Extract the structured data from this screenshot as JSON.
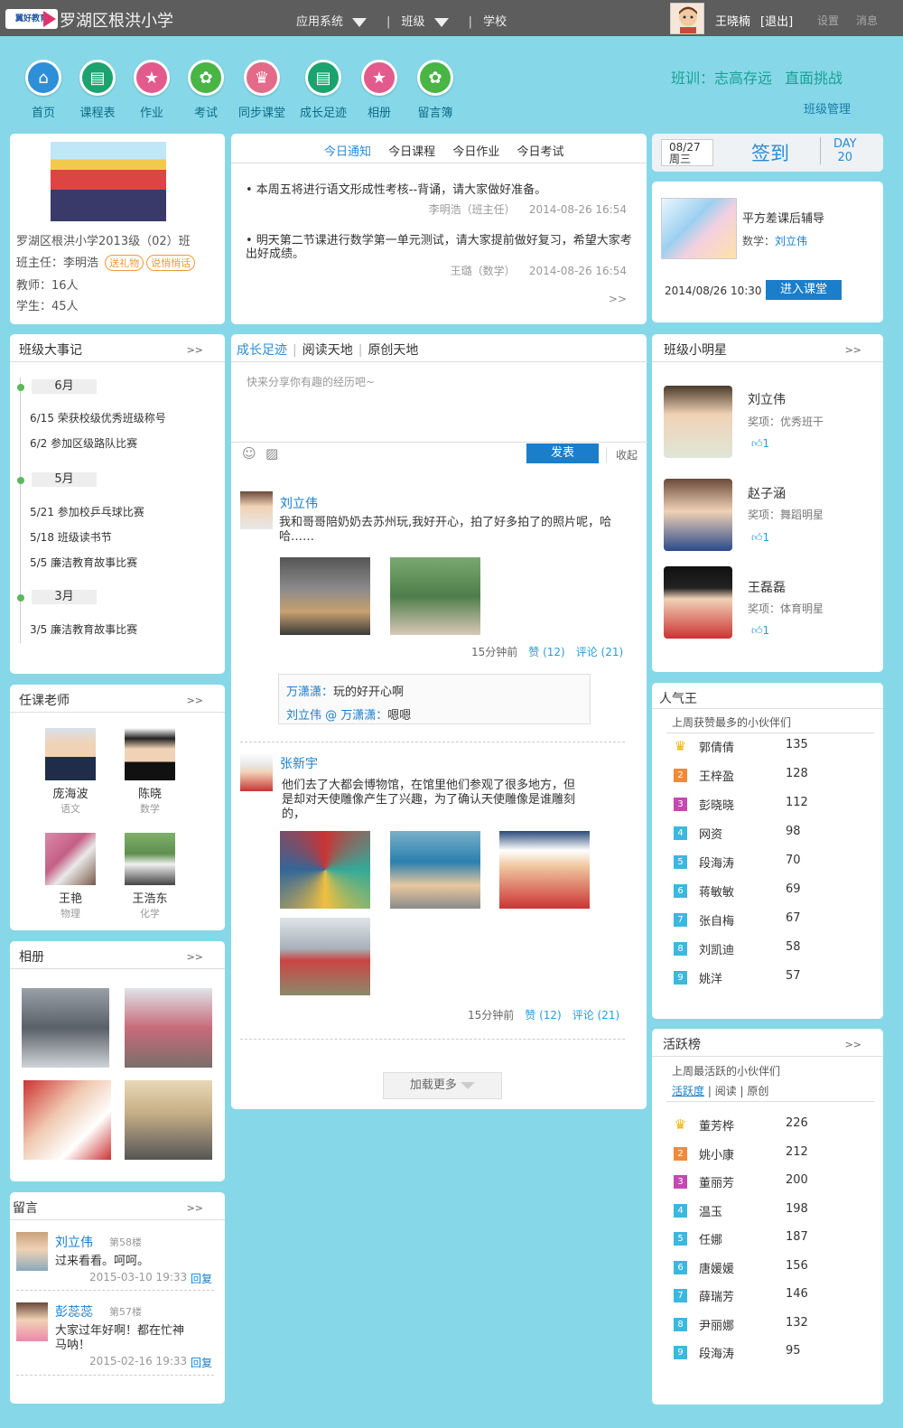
{
  "top": {
    "logo_text": "翼好教育",
    "school": "罗湖区根洪小学",
    "nav": [
      "应用系统",
      "班级",
      "学校"
    ],
    "user": "王晓楠",
    "logout": "[退出]",
    "settings": "设置",
    "messages": "消息"
  },
  "iconnav": [
    {
      "label": "首页",
      "color": "#2d8fd8"
    },
    {
      "label": "课程表",
      "color": "#1aa36f"
    },
    {
      "label": "作业",
      "color": "#e25b8c"
    },
    {
      "label": "考试",
      "color": "#48b545"
    },
    {
      "label": "同步课堂",
      "color": "#e46a8a"
    },
    {
      "label": "成长足迹",
      "color": "#1aa36f"
    },
    {
      "label": "相册",
      "color": "#e25b8c"
    },
    {
      "label": "留言簿",
      "color": "#48b545"
    }
  ],
  "motto": {
    "prefix": "班训：",
    "text": "志高存远",
    "challenge": "直面挑战",
    "manage": "班级管理"
  },
  "class_info": {
    "name": "罗湖区根洪小学2013级（02）班",
    "head_teacher": "班主任：李明浩",
    "tag_gift": "送礼物",
    "tag_talk": "说悄悄话",
    "teachers": "教师：16人",
    "students": "学生：45人"
  },
  "notice": {
    "tabs": [
      "今日通知",
      "今日课程",
      "今日作业",
      "今日考试"
    ],
    "items": [
      {
        "text": "• 本周五将进行语文形成性考核--背诵，请大家做好准备。",
        "author": "李明浩（班主任）",
        "time": "2014-08-26 16:54"
      },
      {
        "text": "• 明天第二节课进行数学第一单元测试，请大家提前做好复习，希望大家考出好成绩。",
        "author": "王璐（数学）",
        "time": "2014-08-26 16:54"
      }
    ],
    "more": ">>"
  },
  "sign": {
    "date": "08/27",
    "weekday": "周三",
    "button": "签到",
    "day_label": "DAY",
    "day_num": "20"
  },
  "course": {
    "title": "平方差课后辅导",
    "subject_label": "数学：",
    "teacher": "刘立伟",
    "datetime": "2014/08/26  10:30",
    "enter": "进入课堂"
  },
  "events": {
    "title": "班级大事记",
    "more": ">>",
    "groups": [
      {
        "month": "6月",
        "items": [
          "6/15  荣获校级优秀班级称号",
          "6/2   参加区级路队比赛"
        ]
      },
      {
        "month": "5月",
        "items": [
          "5/21  参加校乒乓球比赛",
          "5/18  班级读书节",
          "5/5   廉洁教育故事比赛"
        ]
      },
      {
        "month": "3月",
        "items": [
          "3/5   廉洁教育故事比赛"
        ]
      }
    ]
  },
  "teachers": {
    "title": "任课老师",
    "more": ">>",
    "list": [
      {
        "name": "庞海波",
        "subject": "语文"
      },
      {
        "name": "陈晓",
        "subject": "数学"
      },
      {
        "name": "王艳",
        "subject": "物理"
      },
      {
        "name": "王浩东",
        "subject": "化学"
      }
    ]
  },
  "album": {
    "title": "相册",
    "more": ">>"
  },
  "guestbook": {
    "title": "留言",
    "more": ">>",
    "messages": [
      {
        "name": "刘立伟",
        "floor": "第58楼",
        "text": "过来看看。呵呵。",
        "time": "2015-03-10 19:33",
        "reply": "回复"
      },
      {
        "name": "彭蕊蕊",
        "floor": "第57楼",
        "text": "大家过年好啊！都在忙神马呐！",
        "time": "2015-02-16 19:33",
        "reply": "回复"
      }
    ]
  },
  "feed": {
    "tabs": [
      "成长足迹",
      "阅读天地",
      "原创天地"
    ],
    "placeholder": "快来分享你有趣的经历吧~",
    "publish": "发表",
    "collapse": "收起",
    "posts": [
      {
        "name": "刘立伟",
        "text": "我和哥哥陪奶奶去苏州玩,我好开心，拍了好多拍了的照片呢，哈哈……",
        "time": "15分钟前",
        "likes": "赞 (12)",
        "comments_label": "评论 (21)",
        "comments": [
          {
            "who": "万潇潇：",
            "text": "玩的好开心啊"
          },
          {
            "who": "刘立伟 @ 万潇潇：",
            "text": "嗯嗯"
          }
        ]
      },
      {
        "name": "张新宇",
        "text": "他们去了大都会博物馆，在馆里他们参观了很多地方，但是却对天使雕像产生了兴趣，为了确认天使雕像是谁雕刻的，",
        "time": "15分钟前",
        "likes": "赞 (12)",
        "comments_label": "评论 (21)"
      }
    ],
    "load_more": "加载更多"
  },
  "stars": {
    "title": "班级小明星",
    "more": ">>",
    "list": [
      {
        "name": "刘立伟",
        "award": "奖项：优秀班干",
        "likes": "1"
      },
      {
        "name": "赵子涵",
        "award": "奖项：舞蹈明星",
        "likes": "1"
      },
      {
        "name": "王磊磊",
        "award": "奖项：体育明星",
        "likes": "1"
      }
    ]
  },
  "popular": {
    "title": "人气王",
    "subtitle": "上周获赞最多的小伙伴们",
    "list": [
      {
        "rank": "1",
        "name": "郭倩倩",
        "score": "135"
      },
      {
        "rank": "2",
        "name": "王梓盈",
        "score": "128"
      },
      {
        "rank": "3",
        "name": "彭晓晓",
        "score": "112"
      },
      {
        "rank": "4",
        "name": "网资",
        "score": "98"
      },
      {
        "rank": "5",
        "name": "段海涛",
        "score": "70"
      },
      {
        "rank": "6",
        "name": "蒋敏敏",
        "score": "69"
      },
      {
        "rank": "7",
        "name": "张自梅",
        "score": "67"
      },
      {
        "rank": "8",
        "name": "刘凯迪",
        "score": "58"
      },
      {
        "rank": "9",
        "name": "姚洋",
        "score": "57"
      }
    ]
  },
  "active": {
    "title": "活跃榜",
    "more": ">>",
    "subtitle": "上周最活跃的小伙伴们",
    "filters": [
      "活跃度",
      "阅读",
      "原创"
    ],
    "list": [
      {
        "rank": "1",
        "name": "董芳桦",
        "score": "226"
      },
      {
        "rank": "2",
        "name": "姚小康",
        "score": "212"
      },
      {
        "rank": "3",
        "name": "董丽芳",
        "score": "200"
      },
      {
        "rank": "4",
        "name": "温玉",
        "score": "198"
      },
      {
        "rank": "5",
        "name": "任娜",
        "score": "187"
      },
      {
        "rank": "6",
        "name": "唐媛媛",
        "score": "156"
      },
      {
        "rank": "7",
        "name": "薛瑞芳",
        "score": "146"
      },
      {
        "rank": "8",
        "name": "尹丽娜",
        "score": "132"
      },
      {
        "rank": "9",
        "name": "段海涛",
        "score": "95"
      }
    ]
  },
  "colors": {
    "accent": "#1a7ecb",
    "background": "#86d8e8",
    "motto": "#1aa093"
  }
}
